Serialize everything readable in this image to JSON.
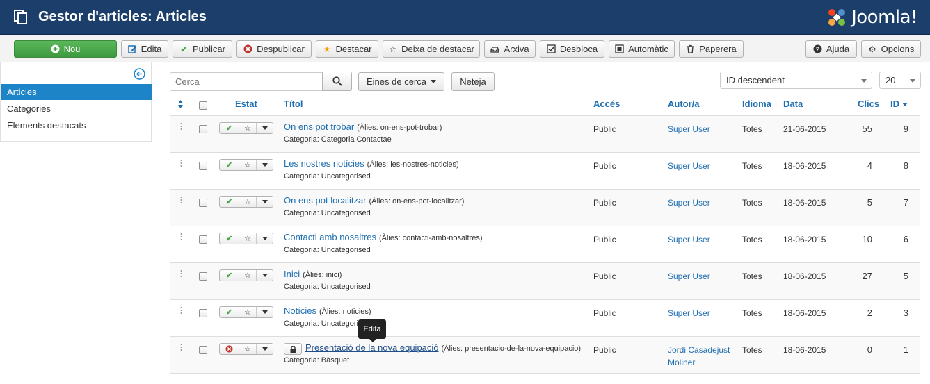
{
  "header": {
    "title": "Gestor d'articles: Articles",
    "logo_text": "Joomla!"
  },
  "toolbar": {
    "new": "Nou",
    "edit": "Edita",
    "publish": "Publicar",
    "unpublish": "Despublicar",
    "feature": "Destacar",
    "unfeature": "Deixa de destacar",
    "archive": "Arxiva",
    "checkin": "Desbloca",
    "auto": "Automàtic",
    "trash": "Paperera",
    "help": "Ajuda",
    "options": "Opcions"
  },
  "sidebar": {
    "items": [
      {
        "label": "Articles"
      },
      {
        "label": "Categories"
      },
      {
        "label": "Elements destacats"
      }
    ]
  },
  "filters": {
    "search_placeholder": "Cerca",
    "search_tools": "Eines de cerca",
    "clear": "Neteja",
    "ordering": "ID descendent",
    "limit": "20"
  },
  "table": {
    "headers": {
      "status": "Estat",
      "title": "Títol",
      "access": "Accés",
      "author": "Autor/a",
      "language": "Idioma",
      "date": "Data",
      "hits": "Clics",
      "id": "ID"
    },
    "rows": [
      {
        "title": "On ens pot trobar",
        "alias": "(Àlies: on-ens-pot-trobar)",
        "category": "Categoria: Categoria Contactae",
        "access": "Public",
        "author": "Super User",
        "author2": "",
        "language": "Totes",
        "date": "21-06-2015",
        "hits": "55",
        "id": "9",
        "published": true,
        "locked": false
      },
      {
        "title": "Les nostres notícies",
        "alias": "(Àlies: les-nostres-noticies)",
        "category": "Categoria: Uncategorised",
        "access": "Public",
        "author": "Super User",
        "author2": "",
        "language": "Totes",
        "date": "18-06-2015",
        "hits": "4",
        "id": "8",
        "published": true,
        "locked": false
      },
      {
        "title": "On ens pot localitzar",
        "alias": "(Àlies: on-ens-pot-localitzar)",
        "category": "Categoria: Uncategorised",
        "access": "Public",
        "author": "Super User",
        "author2": "",
        "language": "Totes",
        "date": "18-06-2015",
        "hits": "5",
        "id": "7",
        "published": true,
        "locked": false
      },
      {
        "title": "Contacti amb nosaltres",
        "alias": "(Àlies: contacti-amb-nosaltres)",
        "category": "Categoria: Uncategorised",
        "access": "Public",
        "author": "Super User",
        "author2": "",
        "language": "Totes",
        "date": "18-06-2015",
        "hits": "10",
        "id": "6",
        "published": true,
        "locked": false
      },
      {
        "title": "Inici",
        "alias": "(Àlies: inici)",
        "category": "Categoria: Uncategorised",
        "access": "Public",
        "author": "Super User",
        "author2": "",
        "language": "Totes",
        "date": "18-06-2015",
        "hits": "27",
        "id": "5",
        "published": true,
        "locked": false
      },
      {
        "title": "Notícies",
        "alias": "(Àlies: noticies)",
        "category": "Categoria: Uncategorised",
        "access": "Public",
        "author": "Super User",
        "author2": "",
        "language": "Totes",
        "date": "18-06-2015",
        "hits": "2",
        "id": "3",
        "published": true,
        "locked": false
      },
      {
        "title": "Presentació de la nova equipació",
        "alias": "(Àlies: presentacio-de-la-nova-equipacio)",
        "category": "Categoria: Bàsquet",
        "access": "Public",
        "author": "Jordi Casadejust",
        "author2": "Moliner",
        "language": "Totes",
        "date": "18-06-2015",
        "hits": "0",
        "id": "1",
        "published": false,
        "locked": true
      }
    ]
  },
  "tooltip": {
    "text": "Edita"
  },
  "colors": {
    "header_bg": "#1b3e6b",
    "accent": "#1e84c8",
    "success": "#46a546",
    "danger": "#bd362f"
  }
}
